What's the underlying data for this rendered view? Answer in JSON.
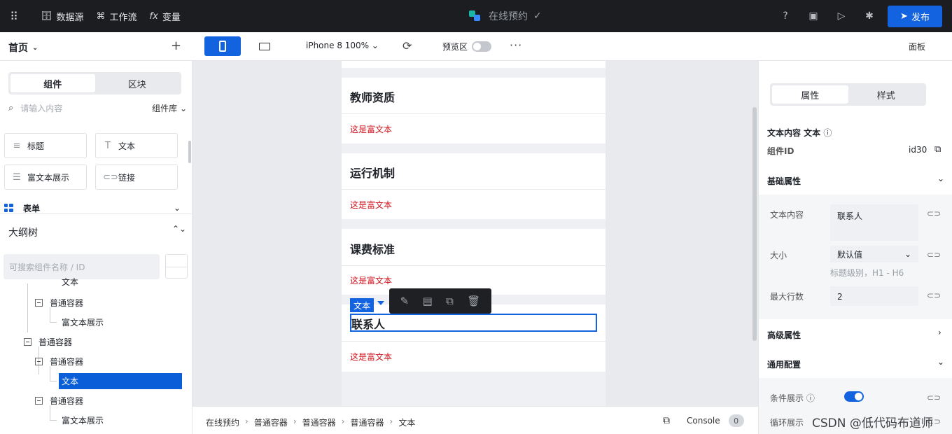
{
  "topbar": {
    "datasource": "数据源",
    "workflow": "工作流",
    "variable": "变量",
    "app_title": "在线预约",
    "publish": "发布"
  },
  "toolbar": {
    "home": "首页",
    "device": "iPhone 8 100%",
    "preview": "预览区",
    "panel": "面板"
  },
  "left": {
    "tabs": [
      "组件",
      "区块"
    ],
    "search_placeholder": "请输入内容",
    "library": "组件库",
    "components": [
      {
        "label": "标题",
        "icon": "heading-icon"
      },
      {
        "label": "文本",
        "icon": "text-icon"
      },
      {
        "label": "富文本展示",
        "icon": "richtext-icon"
      },
      {
        "label": "链接",
        "icon": "link-icon"
      }
    ],
    "form_group": "表单",
    "outline": "大纲树",
    "tree_search_placeholder": "可搜索组件名称 / ID",
    "tree": [
      {
        "label": "文本",
        "level": 2,
        "partial": true
      },
      {
        "label": "普通容器",
        "level": 1
      },
      {
        "label": "富文本展示",
        "level": 2
      },
      {
        "label": "普通容器",
        "level": 0
      },
      {
        "label": "普通容器",
        "level": 1
      },
      {
        "label": "文本",
        "level": 2,
        "selected": true
      },
      {
        "label": "普通容器",
        "level": 1
      },
      {
        "label": "富文本展示",
        "level": 2
      }
    ]
  },
  "canvas": {
    "sections": [
      {
        "title": "教师资质",
        "rich": "这是富文本"
      },
      {
        "title": "运行机制",
        "rich": "这是富文本"
      },
      {
        "title": "课费标准",
        "rich": "这是富文本"
      },
      {
        "title": "联系人",
        "rich": "这是富文本"
      }
    ],
    "selected_tag": "文本"
  },
  "status": {
    "breadcrumbs": [
      "在线预约",
      "普通容器",
      "普通容器",
      "普通容器",
      "文本"
    ],
    "console": "Console",
    "console_count": "0"
  },
  "right": {
    "tabs": [
      "属性",
      "样式"
    ],
    "component_title": "文本内容 文本",
    "component_id_label": "组件ID",
    "component_id": "id30",
    "basic": "基础属性",
    "text_content_label": "文本内容",
    "text_content_value": "联系人",
    "size_label": "大小",
    "size_value": "默认值",
    "size_hint": "标题级别，H1 - H6",
    "max_lines_label": "最大行数",
    "max_lines_value": "2",
    "advanced": "高级属性",
    "common": "通用配置",
    "condition_label": "条件展示",
    "loop_label": "循环展示"
  },
  "watermark": "CSDN @低代码布道师",
  "colors": {
    "accent": "#1363e0",
    "rich_text": "#d0121b",
    "topbar": "#1c1d20"
  }
}
